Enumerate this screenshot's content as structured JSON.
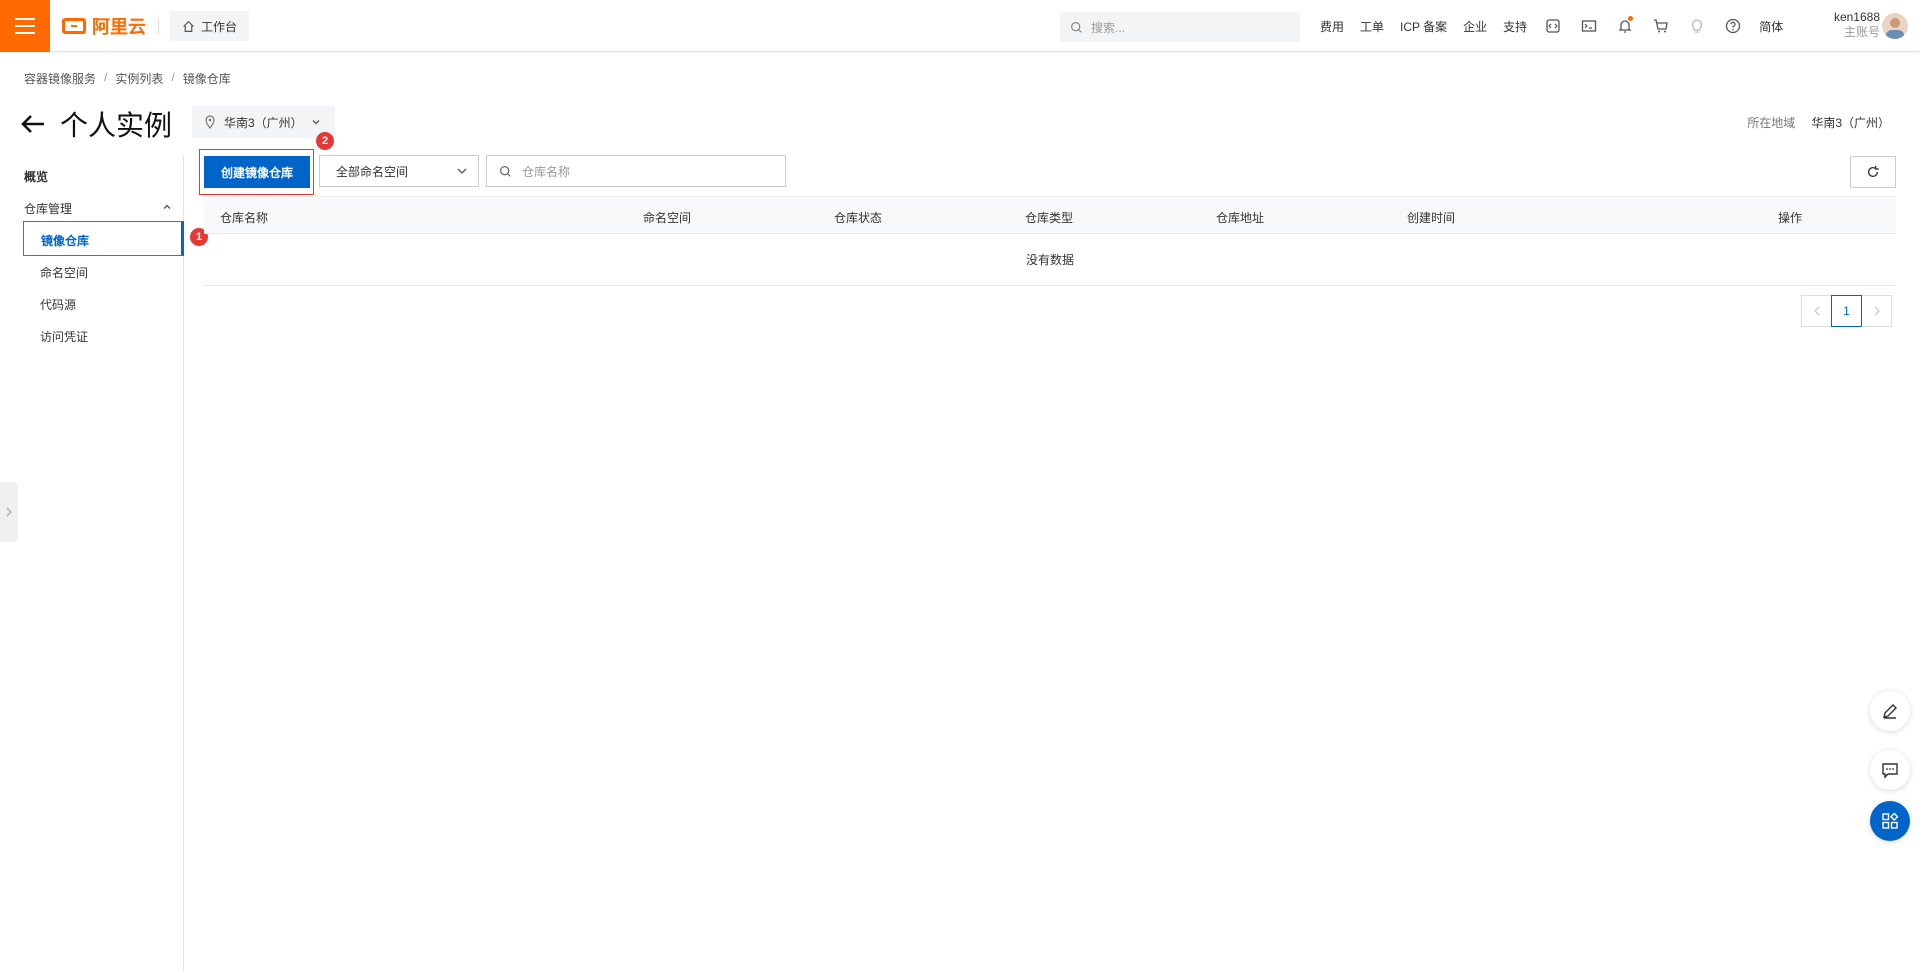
{
  "topbar": {
    "logo_text": "阿里云",
    "workbench_label": "工作台",
    "search_placeholder": "搜索...",
    "nav": [
      "费用",
      "工单",
      "ICP 备案",
      "企业",
      "支持"
    ],
    "lang": "简体",
    "user_name": "ken1688",
    "user_role": "主账号"
  },
  "breadcrumb": [
    "容器镜像服务",
    "实例列表",
    "镜像仓库"
  ],
  "page": {
    "title": "个人实例",
    "region_select": "华南3（广州）",
    "region_label": "所在地域",
    "region_value": "华南3（广州）"
  },
  "sidebar": {
    "overview": "概览",
    "group": "仓库管理",
    "items": [
      "镜像仓库",
      "命名空间",
      "代码源",
      "访问凭证"
    ]
  },
  "annotations": {
    "badge1": "1",
    "badge2": "2"
  },
  "toolbar": {
    "create_label": "创建镜像仓库",
    "namespace_select": "全部命名空间",
    "repo_search_placeholder": "仓库名称"
  },
  "table": {
    "columns": [
      "仓库名称",
      "命名空间",
      "仓库状态",
      "仓库类型",
      "仓库地址",
      "创建时间",
      "操作"
    ],
    "empty_text": "没有数据"
  },
  "pagination": {
    "current": "1"
  },
  "colors": {
    "accent": "#ff6a00",
    "primary": "#0064c8",
    "highlight": "#e53935"
  }
}
